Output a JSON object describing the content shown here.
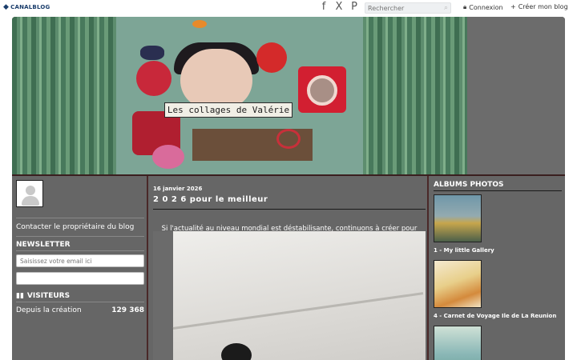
{
  "topbar": {
    "logo": "CANALBLOG",
    "social": [
      "f",
      "X",
      "P"
    ],
    "search_placeholder": "Rechercher",
    "login_label": "Connexion",
    "create_label": "Créer mon blog"
  },
  "banner": {
    "title": "Les collages de Valérie"
  },
  "sidebar_left": {
    "contact": "Contacter le propriétaire du blog",
    "newsletter_title": "NEWSLETTER",
    "email_placeholder": "Saisissez votre email ici",
    "visitors_title": "VISITEURS",
    "visitors_label": "Depuis la création",
    "visitors_count": "129 368"
  },
  "post": {
    "date": "16 janvier 2026",
    "title": "2 0 2 6 pour le meilleur",
    "text": "Si l'actualité au niveau mondial est déstabilisante, continuons à créer pour mieux résister et à croire à des jours meilleurs."
  },
  "sidebar_right": {
    "albums_title": "ALBUMS PHOTOS",
    "albums": [
      {
        "label": "1 - My little Gallery"
      },
      {
        "label": "4 - Carnet de Voyage Ile de La Reunion"
      }
    ]
  },
  "colors": {
    "page_bg": "#666666",
    "column_border": "#4a2828",
    "logo": "#1a3d6b"
  }
}
